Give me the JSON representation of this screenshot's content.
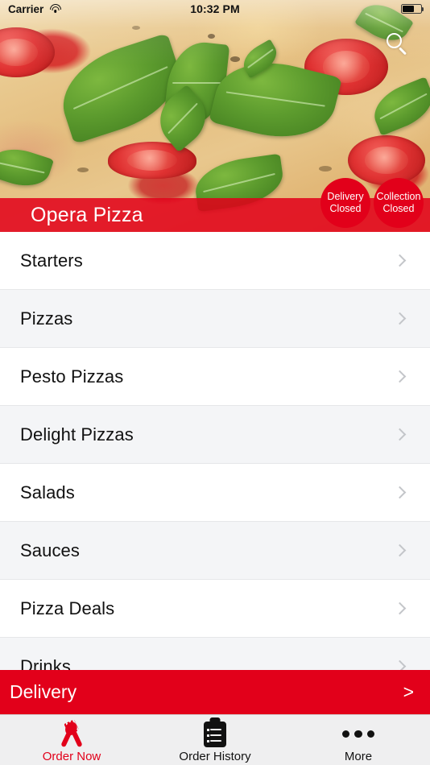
{
  "status_bar": {
    "carrier": "Carrier",
    "time": "10:32 PM",
    "wifi_icon": "wifi-icon",
    "battery_icon": "battery-icon"
  },
  "hero": {
    "search_icon": "search-icon",
    "restaurant_name": "Opera Pizza",
    "badges": [
      {
        "line1": "Delivery",
        "line2": "Closed"
      },
      {
        "line1": "Collection",
        "line2": "Closed"
      }
    ]
  },
  "menu": {
    "chevron_icon": "chevron-right-icon",
    "categories": [
      {
        "label": "Starters"
      },
      {
        "label": "Pizzas"
      },
      {
        "label": "Pesto Pizzas"
      },
      {
        "label": "Delight Pizzas"
      },
      {
        "label": "Salads"
      },
      {
        "label": "Sauces"
      },
      {
        "label": "Pizza Deals"
      },
      {
        "label": "Drinks"
      }
    ]
  },
  "delivery_bar": {
    "label": "Delivery",
    "chevron": ">"
  },
  "tabbar": {
    "tabs": [
      {
        "label": "Order Now",
        "icon": "cutlery-icon",
        "active": true
      },
      {
        "label": "Order History",
        "icon": "clipboard-icon",
        "active": false
      },
      {
        "label": "More",
        "icon": "ellipsis-icon",
        "active": false
      }
    ]
  },
  "colors": {
    "brand_red": "#e2001a",
    "row_alt": "#f4f5f7",
    "tabbar_bg": "#efeff0",
    "chevron_gray": "#c3c5c9"
  }
}
